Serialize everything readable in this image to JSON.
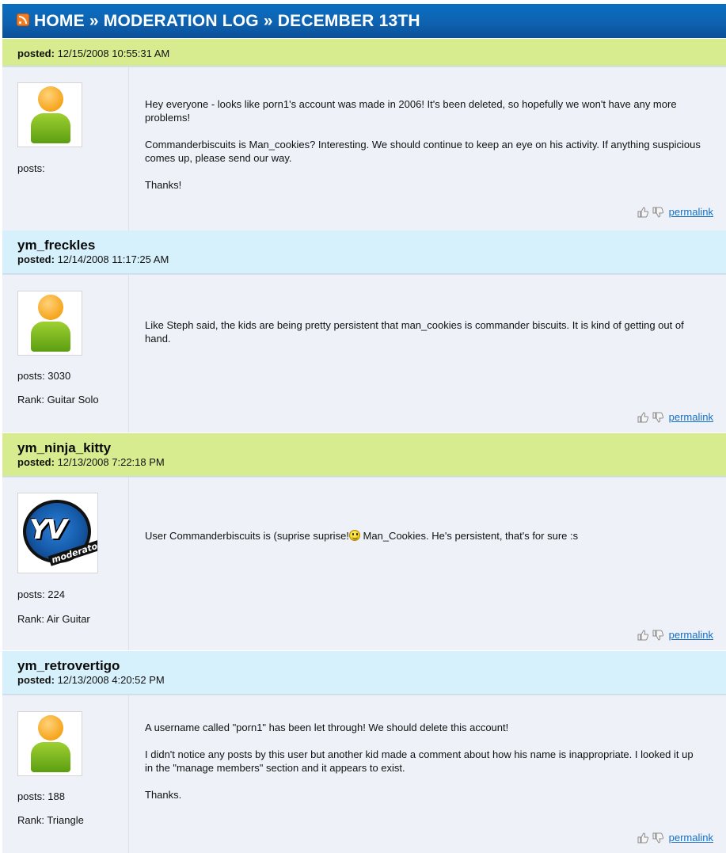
{
  "header": {
    "title": "HOME » MODERATION LOG » DECEMBER 13TH"
  },
  "labels": {
    "posted": "posted:",
    "permalink": "permalink"
  },
  "posts": [
    {
      "author": "",
      "posted": "12/15/2008 10:55:31 AM",
      "posts_count": "posts:",
      "rank": "",
      "avatar": "default-user",
      "paragraphs": [
        "Hey everyone - looks like porn1's account was made in 2006! It's been deleted, so hopefully we won't have any more problems!",
        "Commanderbiscuits is Man_cookies? Interesting. We should continue to keep an eye on his activity. If anything suspicious comes up, please send our way.",
        "Thanks!"
      ]
    },
    {
      "author": "ym_freckles",
      "posted": "12/14/2008 11:17:25 AM",
      "posts_count": "posts: 3030",
      "rank": "Rank: Guitar Solo",
      "avatar": "default-user",
      "paragraphs": [
        "Like Steph said, the kids are being pretty persistent that man_cookies is commander biscuits. It is kind of getting out of hand."
      ]
    },
    {
      "author": "ym_ninja_kitty",
      "posted": "12/13/2008 7:22:18 PM",
      "posts_count": "posts: 224",
      "rank": "Rank: Air Guitar",
      "avatar": "yv-moderator",
      "avatar_text": "YV",
      "avatar_sub": "moderator",
      "text_before": "User Commanderbiscuits is (suprise suprise!",
      "text_after": " Man_Cookies. He's persistent, that's for sure :s"
    },
    {
      "author": "ym_retrovertigo",
      "posted": "12/13/2008 4:20:52 PM",
      "posts_count": "posts: 188",
      "rank": "Rank: Triangle",
      "avatar": "default-user",
      "paragraphs": [
        "A username called \"porn1\" has been let through! We should delete this account!",
        "I didn't notice any posts by this user but another kid made a comment about how his name is inappropriate. I looked it up in the \"manage members\" section and it appears to exist.",
        "Thanks."
      ]
    }
  ]
}
